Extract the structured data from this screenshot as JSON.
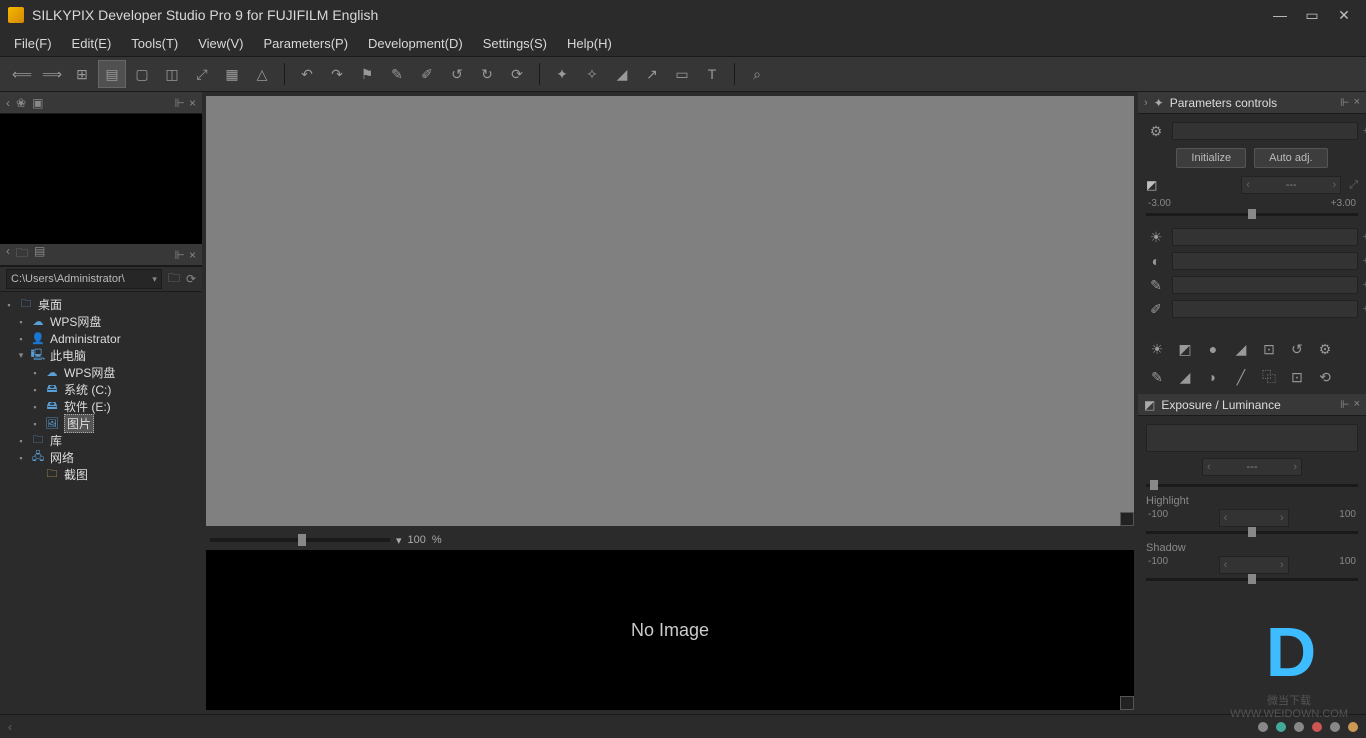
{
  "window": {
    "title": "SILKYPIX Developer Studio Pro 9 for FUJIFILM English"
  },
  "menu": {
    "file": "File(F)",
    "edit": "Edit(E)",
    "tools": "Tools(T)",
    "view": "View(V)",
    "parameters": "Parameters(P)",
    "development": "Development(D)",
    "settings": "Settings(S)",
    "help": "Help(H)"
  },
  "folder": {
    "path": "C:\\Users\\Administrator\\"
  },
  "tree": {
    "desktop": "桌面",
    "wps1": "WPS网盘",
    "admin": "Administrator",
    "thispc": "此电脑",
    "wps2": "WPS网盘",
    "sysc": "系统 (C:)",
    "softe": "软件 (E:)",
    "pictures": "图片",
    "library": "库",
    "network": "网络",
    "screenshot": "截图"
  },
  "zoom": {
    "value": "100",
    "unit": "%"
  },
  "noimage": "No Image",
  "params_panel": {
    "title": "Parameters controls",
    "initialize": "Initialize",
    "autoadj": "Auto adj.",
    "dash": "---",
    "exp_min": "-3.00",
    "exp_max": "+3.00"
  },
  "exposure_panel": {
    "title": "Exposure / Luminance",
    "dash": "---",
    "highlight_label": "Highlight",
    "highlight_min": "-100",
    "highlight_max": "100",
    "shadow_label": "Shadow",
    "shadow_min": "-100",
    "shadow_max": "100"
  },
  "watermark": {
    "text1": "微当下载",
    "text2": "WWW.WEIDOWN.COM"
  }
}
